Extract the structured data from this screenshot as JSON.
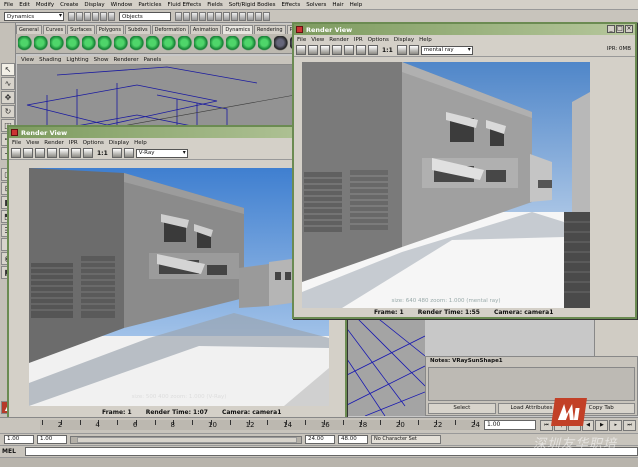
{
  "menubar": {
    "items": [
      "File",
      "Edit",
      "Modify",
      "Create",
      "Display",
      "Window",
      "Particles",
      "Fluid Effects",
      "Fields",
      "Soft/Rigid Bodies",
      "Effects",
      "Solvers",
      "Hair",
      "Help"
    ]
  },
  "statusline": {
    "mode": "Dynamics",
    "selection_field": "Objects"
  },
  "shelf": {
    "tabs": [
      "General",
      "Curves",
      "Surfaces",
      "Polygons",
      "Subdivs",
      "Deformation",
      "Animation",
      "Dynamics",
      "Rendering",
      "PaintEffe"
    ],
    "active_tab": "Dynamics"
  },
  "viewport": {
    "menu": [
      "View",
      "Shading",
      "Lighting",
      "Show",
      "Renderer",
      "Panels"
    ]
  },
  "render_view_vray": {
    "title": "Render View",
    "menu": [
      "File",
      "View",
      "Render",
      "IPR",
      "Options",
      "Display",
      "Help"
    ],
    "ratio": "1:1",
    "renderer": "V-Ray",
    "info": "size: 500 400 zoom: 1.000 (V-Ray)",
    "frame_label": "Frame: 1",
    "time_label": "Render Time: 1:07",
    "camera_label": "Camera: camera1"
  },
  "render_view_mr": {
    "title": "Render View",
    "menu": [
      "File",
      "View",
      "Render",
      "IPR",
      "Options",
      "Display",
      "Help"
    ],
    "ratio": "1:1",
    "renderer": "mental ray",
    "ipr_label": "IPR: 0MB",
    "info": "size: 640 480 zoom: 1.000 (mental ray)",
    "frame_label": "Frame: 1",
    "time_label": "Render Time: 1:55",
    "camera_label": "Camera: camera1"
  },
  "notes": {
    "title": "Notes: VRaySunShape1",
    "buttons": [
      "Select",
      "Load Attributes",
      "Copy Tab"
    ]
  },
  "time_slider": {
    "ticks": [
      "2",
      "4",
      "6",
      "8",
      "10",
      "12",
      "14",
      "16",
      "18",
      "20",
      "22",
      "24"
    ],
    "current_frame": "1.00"
  },
  "range_slider": {
    "start": "1.00",
    "inner_start": "1.00",
    "inner_end": "24.00",
    "end": "48.00",
    "character_set": "No Character Set"
  },
  "command_line": {
    "label": "MEL"
  },
  "watermark": {
    "text": "深圳友华职培"
  },
  "colors": {
    "titlebar": "#7d9b5f",
    "logo": "#c24027"
  }
}
